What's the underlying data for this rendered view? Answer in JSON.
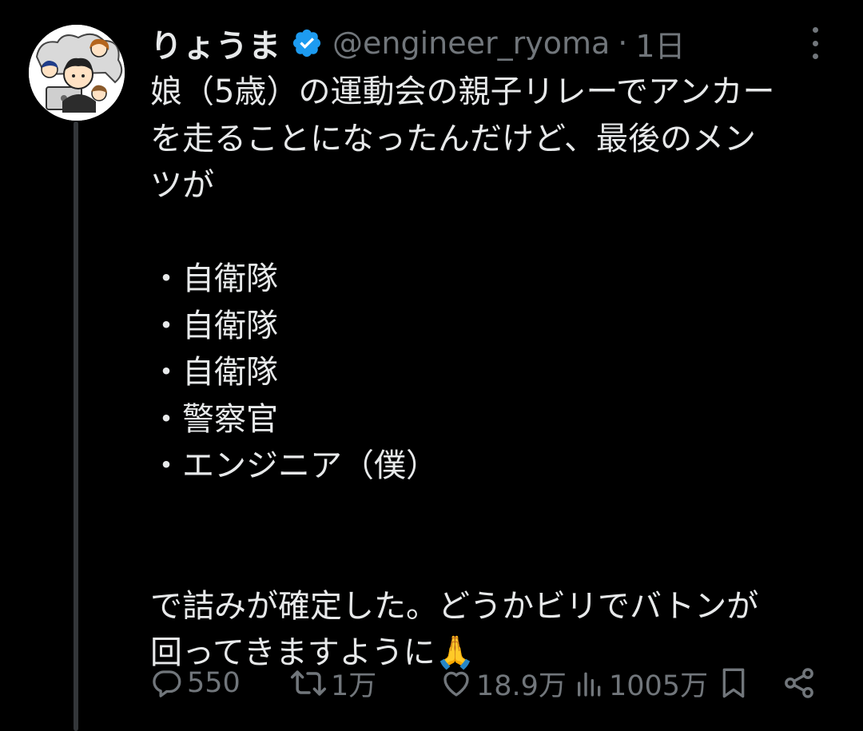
{
  "author": {
    "display_name": "りょうま",
    "verified": true,
    "handle": "@engineer_ryoma",
    "separator": "·",
    "time": "1日"
  },
  "tweet": {
    "lines": [
      "娘（5歳）の運動会の親子リレーでアンカー",
      "を走ることになったんだけど、最後のメン",
      "ツが",
      "",
      "・自衛隊",
      "・自衛隊",
      "・自衛隊",
      "・警察官",
      "・エンジニア（僕）",
      "",
      "",
      "で詰みが確定した。どうかビリでバトンが",
      "回ってきますように🙏"
    ]
  },
  "actions": {
    "replies": "550",
    "reposts": "1万",
    "likes": "18.9万",
    "views": "1005万"
  },
  "icons": {
    "more": "more-icon",
    "verified": "verified-badge-icon",
    "reply": "reply-icon",
    "repost": "repost-icon",
    "like": "like-icon",
    "views": "views-icon",
    "bookmark": "bookmark-icon",
    "share": "share-icon"
  },
  "colors": {
    "background": "#000000",
    "text": "#e7e9ea",
    "muted": "#71767b",
    "verified": "#1d9bf0",
    "thread_line": "#333639"
  }
}
